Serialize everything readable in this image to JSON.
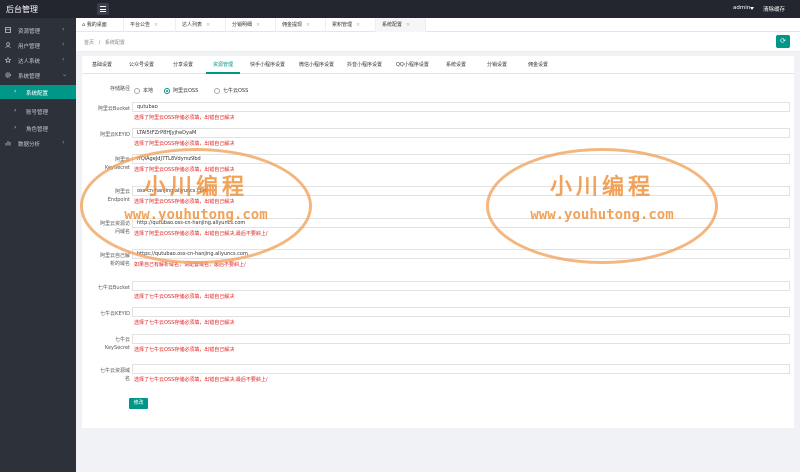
{
  "header": {
    "brand": "后台管理",
    "user": "admin",
    "clear_cache": "清除缓存"
  },
  "sidebar": {
    "items": [
      {
        "label": "资源管理",
        "icon": "box-icon"
      },
      {
        "label": "用户管理",
        "icon": "user-icon"
      },
      {
        "label": "达人系统",
        "icon": "star-icon"
      },
      {
        "label": "系统管理",
        "icon": "gear-icon"
      }
    ],
    "sub_items": [
      {
        "label": "系统配置"
      },
      {
        "label": "账号管理"
      },
      {
        "label": "角色管理"
      }
    ],
    "last": {
      "label": "数据分析",
      "icon": "chart-icon"
    }
  },
  "tabs": [
    {
      "label": "我的桌面"
    },
    {
      "label": "平台公告"
    },
    {
      "label": "达人列表"
    },
    {
      "label": "分销明细"
    },
    {
      "label": "佣金提现"
    },
    {
      "label": "累积管理"
    },
    {
      "label": "系统配置"
    }
  ],
  "breadcrumb": {
    "home": "首页",
    "sep": "/",
    "current": "系统配置"
  },
  "config_tabs": [
    {
      "label": "基础设置"
    },
    {
      "label": "公众号设置"
    },
    {
      "label": "分享设置"
    },
    {
      "label": "资源管理"
    },
    {
      "label": "快手小程序设置"
    },
    {
      "label": "微信小程序设置"
    },
    {
      "label": "抖音小程序设置"
    },
    {
      "label": "QQ小程序设置"
    },
    {
      "label": "系统设置"
    },
    {
      "label": "分销设置"
    },
    {
      "label": "佣金设置"
    }
  ],
  "storage": {
    "label": "存储路径",
    "options": [
      {
        "label": "本地"
      },
      {
        "label": "阿里云OSS"
      },
      {
        "label": "七牛云OSS"
      }
    ]
  },
  "fields": [
    {
      "label": "阿里云Bucket",
      "value": "qutubao",
      "hint": "选择了阿里云OSS存储必须填，出错自己解决"
    },
    {
      "label": "阿里云KEYID",
      "value": "LTAI5tFZrP8HJyjheDyaM",
      "hint": "选择了阿里云OSS存储必须填，出错自己解决"
    },
    {
      "label_line1": "阿里云",
      "label_line2": "KeySecret",
      "value": "rfQiAgeJdJ7TL8Vdymz9bd",
      "hint": "选择了阿里云OSS存储必须填，出错自己解决"
    },
    {
      "label_line1": "阿里云",
      "label_line2": "Endpoint",
      "value": "oss-cn-hanjing.aliyuncs.com",
      "hint": "选择了阿里云OSS存储必须填，出错自己解决"
    },
    {
      "label_line1": "阿里云资源访",
      "label_line2": "问域名",
      "value": "http://qutubao.oss-cn-hanjing.aliyuncs.com",
      "hint": "选择了阿里云OSS存储必须填，出错自己解决,最后不要斜上/"
    },
    {
      "label_line1": "阿里云自己解",
      "label_line2": "析的域名",
      "value": "https://qutubao.oss-cn-hanjing.aliyuncs.com",
      "hint": "如果自己有解析域名，请配置域名，最后不要斜上/"
    },
    {
      "label": "七牛云Bucket",
      "value": "",
      "hint": "选择了七牛云OSS存储必须填，出错自己解决"
    },
    {
      "label": "七牛云KEYID",
      "value": "",
      "hint": "选择了七牛云OSS存储必须填，出错自己解决"
    },
    {
      "label_line1": "七牛云",
      "label_line2": "KeySecret",
      "value": "",
      "hint": "选择了七牛云OSS存储必须填，出错自己解决"
    },
    {
      "label_line1": "七牛云资源域",
      "label_line2": "名",
      "value": "",
      "hint": "选择了七牛云OSS存储必须填，出错自己解决,最后不要斜上/"
    }
  ],
  "submit_label": "修改",
  "watermark": {
    "cn": "小川编程",
    "url": "www.youhutong.com"
  }
}
